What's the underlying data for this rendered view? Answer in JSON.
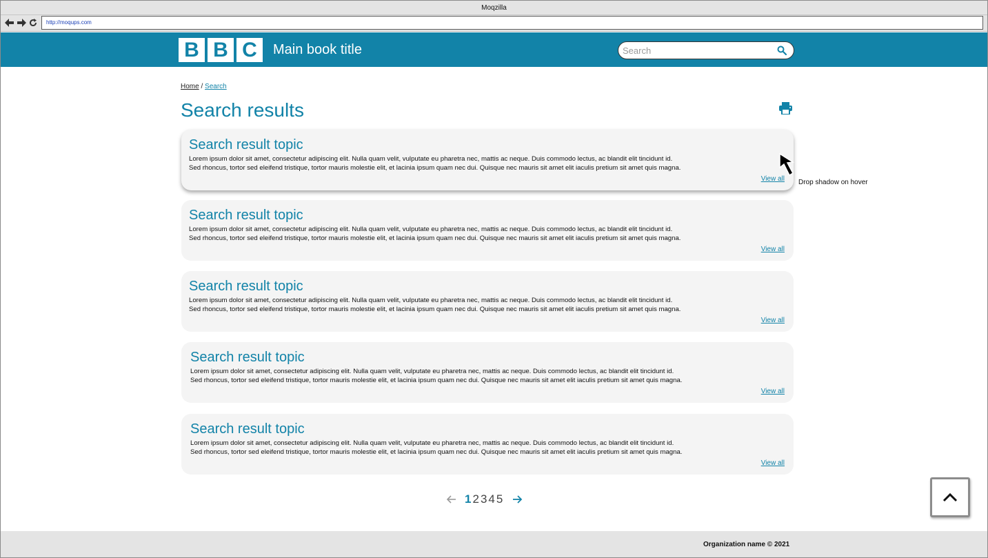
{
  "browser": {
    "window_title": "Moqzilla",
    "url": "http://moqups.com"
  },
  "header": {
    "logo_letters": [
      "B",
      "B",
      "C"
    ],
    "book_title": "Main book title",
    "search_placeholder": "Search"
  },
  "breadcrumb": {
    "home": "Home",
    "separator": "/",
    "current": "Search"
  },
  "page_title": "Search results",
  "results": [
    {
      "title": "Search result topic",
      "line1": "Lorem ipsum dolor sit amet, consectetur adipiscing elit. Nulla quam velit, vulputate eu pharetra nec, mattis ac neque. Duis  commodo lectus, ac blandit elit tincidunt id.",
      "line2": "Sed rhoncus, tortor sed eleifend tristique, tortor mauris molestie elit, et lacinia ipsum quam nec dui. Quisque nec mauris sit amet elit iaculis pretium sit amet quis magna.",
      "link": "View all"
    },
    {
      "title": "Search result topic",
      "line1": "Lorem ipsum dolor sit amet, consectetur adipiscing elit. Nulla quam velit, vulputate eu pharetra nec, mattis ac neque. Duis  commodo lectus, ac blandit elit tincidunt id.",
      "line2": "Sed rhoncus, tortor sed eleifend tristique, tortor mauris molestie elit, et lacinia ipsum quam nec dui. Quisque nec mauris sit amet elit iaculis pretium sit amet quis magna.",
      "link": "View all"
    },
    {
      "title": "Search result topic",
      "line1": "Lorem ipsum dolor sit amet, consectetur adipiscing elit. Nulla quam velit, vulputate eu pharetra nec, mattis ac neque. Duis  commodo lectus, ac blandit elit tincidunt id.",
      "line2": "Sed rhoncus, tortor sed eleifend tristique, tortor mauris molestie elit, et lacinia ipsum quam nec dui. Quisque nec mauris sit amet elit iaculis pretium sit amet quis magna.",
      "link": "View all"
    },
    {
      "title": "Search result topic",
      "line1": "Lorem ipsum dolor sit amet, consectetur adipiscing elit. Nulla quam velit, vulputate eu pharetra nec, mattis ac neque. Duis  commodo lectus, ac blandit elit tincidunt id.",
      "line2": "Sed rhoncus, tortor sed eleifend tristique, tortor mauris molestie elit, et lacinia ipsum quam nec dui. Quisque nec mauris sit amet elit iaculis pretium sit amet quis magna.",
      "link": "View all"
    },
    {
      "title": "Search result topic",
      "line1": "Lorem ipsum dolor sit amet, consectetur adipiscing elit. Nulla quam velit, vulputate eu pharetra nec, mattis ac neque. Duis  commodo lectus, ac blandit elit tincidunt id.",
      "line2": "Sed rhoncus, tortor sed eleifend tristique, tortor mauris molestie elit, et lacinia ipsum quam nec dui. Quisque nec mauris sit amet elit iaculis pretium sit amet quis magna.",
      "link": "View all"
    }
  ],
  "annotation": "Drop shadow on hover",
  "pagination": {
    "pages": [
      "1",
      "2",
      "3",
      "4",
      "5"
    ],
    "current": "1"
  },
  "footer": {
    "text": "Organization name © 2021"
  },
  "colors": {
    "brand": "#1283a8",
    "card_bg": "#f4f4f4",
    "chrome_bg": "#e4e4e4"
  },
  "icons": {
    "back": "arrow-left-icon",
    "forward": "arrow-right-icon",
    "reload": "reload-icon",
    "search": "search-icon",
    "print": "print-icon",
    "cursor": "mouse-pointer-icon",
    "prev_page": "arrow-left-icon",
    "next_page": "arrow-right-icon",
    "back_to_top": "chevron-up-icon"
  }
}
